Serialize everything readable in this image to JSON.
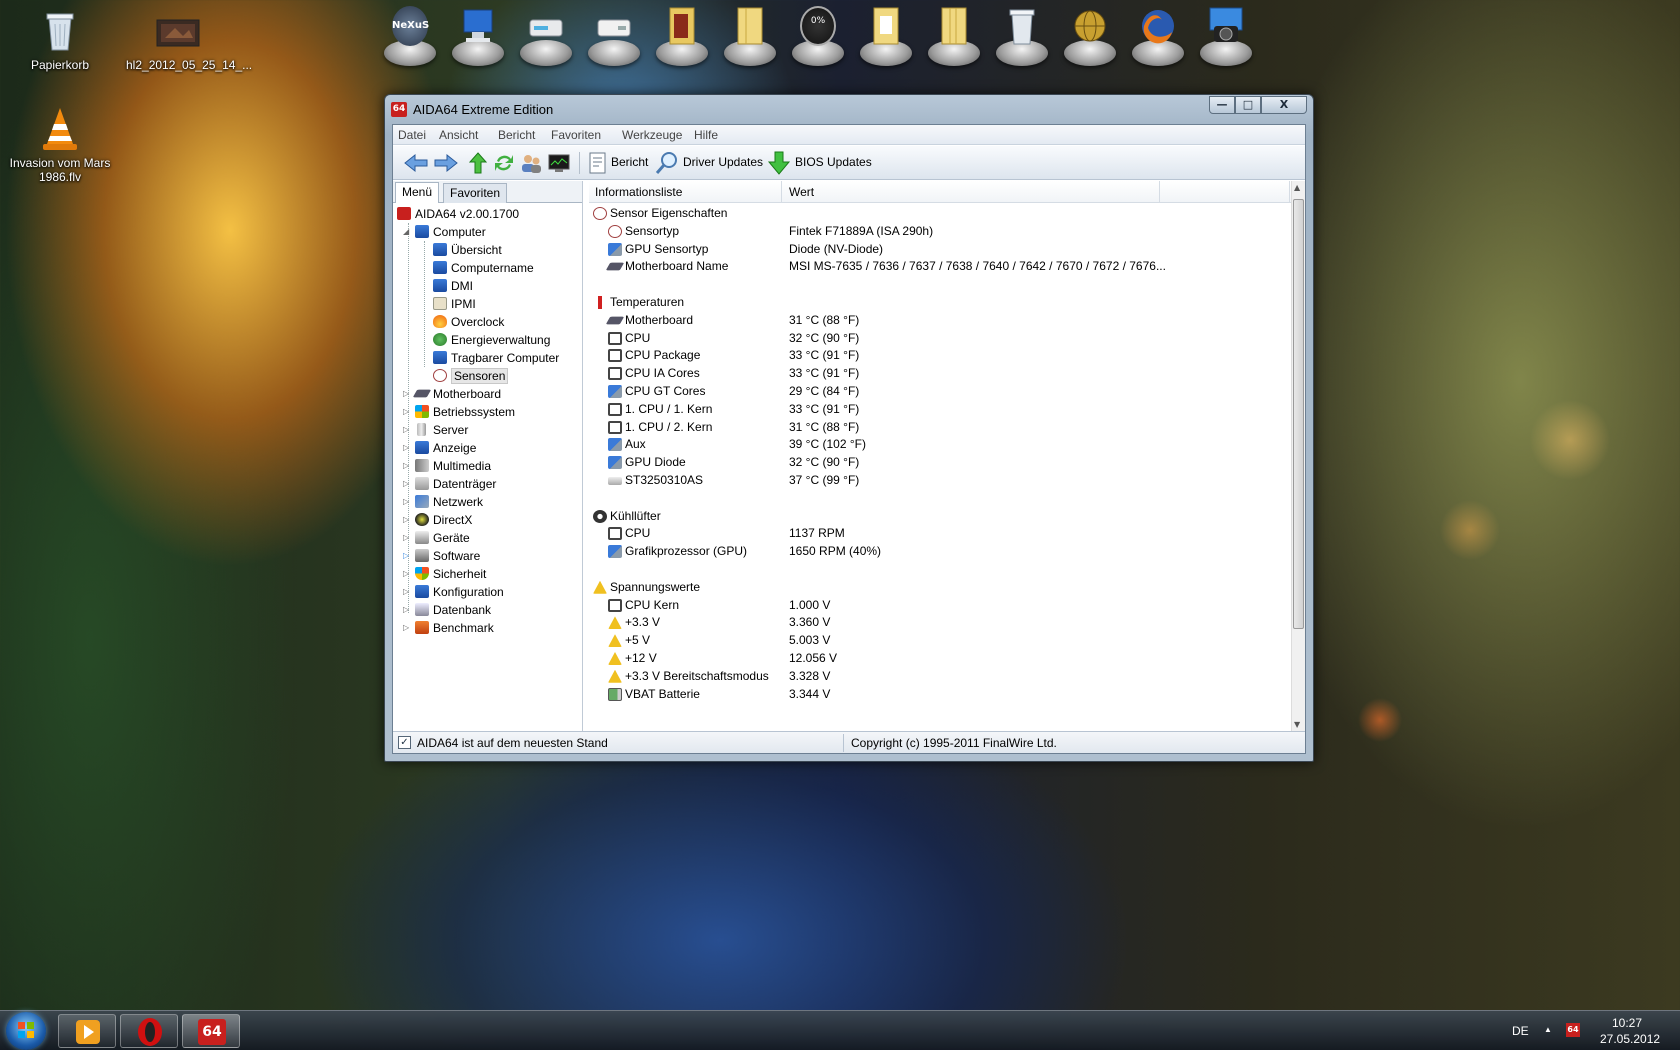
{
  "desktop": {
    "icons": [
      {
        "label": "Papierkorb"
      },
      {
        "label": "hl2_2012_05_25_14_..."
      },
      {
        "label": "Invasion vom Mars 1986.flv"
      }
    ],
    "dock": {
      "items": [
        "nexus-icon",
        "computer-icon",
        "drive-icon",
        "drive-icon",
        "folder-icon",
        "folder-icon",
        "gauge-icon",
        "folder-icon",
        "folder-icon",
        "recycle-bin-icon",
        "globe-icon",
        "firefox-icon",
        "camera-icon"
      ],
      "nexus_label": "NeXuS",
      "gauge_label": "0%"
    }
  },
  "window": {
    "logo_text": "64",
    "title": "AIDA64 Extreme Edition",
    "controls": {
      "minimize": "—",
      "maximize": "□",
      "close": "X"
    },
    "menu": [
      "Datei",
      "Ansicht",
      "Bericht",
      "Favoriten",
      "Werkzeuge",
      "Hilfe"
    ],
    "toolbar": {
      "report": "Bericht",
      "driver_updates": "Driver Updates",
      "bios_updates": "BIOS Updates"
    },
    "tabs": [
      "Menü",
      "Favoriten"
    ],
    "tree": {
      "root": "AIDA64 v2.00.1700",
      "computer": "Computer",
      "computer_children": [
        "Übersicht",
        "Computername",
        "DMI",
        "IPMI",
        "Overclock",
        "Energieverwaltung",
        "Tragbarer Computer",
        "Sensoren"
      ],
      "top": [
        "Motherboard",
        "Betriebssystem",
        "Server",
        "Anzeige",
        "Multimedia",
        "Datenträger",
        "Netzwerk",
        "DirectX",
        "Geräte",
        "Software",
        "Sicherheit",
        "Konfiguration",
        "Datenbank",
        "Benchmark"
      ]
    },
    "list": {
      "columns": [
        "Informationsliste",
        "Wert"
      ],
      "groups": [
        {
          "title": "Sensor Eigenschaften",
          "icon": "sensor-icon",
          "rows": [
            {
              "name": "Sensortyp",
              "value": "Fintek F71889A  (ISA 290h)",
              "icon": "sensor-icon"
            },
            {
              "name": "GPU Sensortyp",
              "value": "Diode  (NV-Diode)",
              "icon": "gpu-icon"
            },
            {
              "name": "Motherboard Name",
              "value": "MSI MS-7635 / 7636 / 7637 / 7638 / 7640 / 7642 / 7670 / 7672 / 7676...",
              "icon": "motherboard-icon"
            }
          ]
        },
        {
          "title": "Temperaturen",
          "icon": "thermometer-icon",
          "rows": [
            {
              "name": "Motherboard",
              "value": "31 °C  (88 °F)",
              "icon": "motherboard-icon"
            },
            {
              "name": "CPU",
              "value": "32 °C  (90 °F)",
              "icon": "cpu-icon"
            },
            {
              "name": "CPU Package",
              "value": "33 °C  (91 °F)",
              "icon": "cpu-icon"
            },
            {
              "name": "CPU IA Cores",
              "value": "33 °C  (91 °F)",
              "icon": "cpu-icon"
            },
            {
              "name": "CPU GT Cores",
              "value": "29 °C  (84 °F)",
              "icon": "gpu-icon"
            },
            {
              "name": "1. CPU / 1. Kern",
              "value": "33 °C  (91 °F)",
              "icon": "cpu-icon"
            },
            {
              "name": "1. CPU / 2. Kern",
              "value": "31 °C  (88 °F)",
              "icon": "cpu-icon"
            },
            {
              "name": "Aux",
              "value": "39 °C  (102 °F)",
              "icon": "gpu-icon"
            },
            {
              "name": "GPU Diode",
              "value": "32 °C  (90 °F)",
              "icon": "gpu-icon"
            },
            {
              "name": "ST3250310AS",
              "value": "37 °C  (99 °F)",
              "icon": "hdd-icon"
            }
          ]
        },
        {
          "title": "Kühllüfter",
          "icon": "fan-icon",
          "rows": [
            {
              "name": "CPU",
              "value": "1137 RPM",
              "icon": "cpu-icon"
            },
            {
              "name": "Grafikprozessor (GPU)",
              "value": "1650 RPM  (40%)",
              "icon": "gpu-icon"
            }
          ]
        },
        {
          "title": "Spannungswerte",
          "icon": "warning-icon",
          "rows": [
            {
              "name": "CPU Kern",
              "value": "1.000 V",
              "icon": "cpu-icon"
            },
            {
              "name": "+3.3 V",
              "value": "3.360 V",
              "icon": "warning-icon"
            },
            {
              "name": "+5 V",
              "value": "5.003 V",
              "icon": "warning-icon"
            },
            {
              "name": "+12 V",
              "value": "12.056 V",
              "icon": "warning-icon"
            },
            {
              "name": "+3.3 V Bereitschaftsmodus",
              "value": "3.328 V",
              "icon": "warning-icon"
            },
            {
              "name": "VBAT Batterie",
              "value": "3.344 V",
              "icon": "battery-icon"
            }
          ]
        }
      ]
    },
    "status": {
      "left": "AIDA64 ist auf dem neuesten Stand",
      "right": "Copyright (c) 1995-2011 FinalWire Ltd."
    }
  },
  "taskbar": {
    "aida_label": "64",
    "language": "DE",
    "tray_up": "▲",
    "tray_aida": "64",
    "time": "10:27",
    "date": "27.05.2012"
  }
}
